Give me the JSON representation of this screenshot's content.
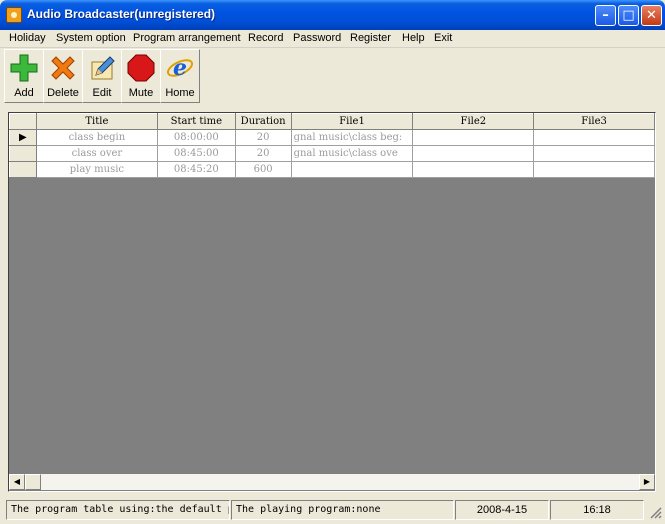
{
  "window": {
    "title": "Audio Broadcaster(unregistered)"
  },
  "menu": [
    "Holiday",
    "System option",
    "Program arrangement",
    "Record",
    "Password",
    "Register",
    "Help",
    "Exit"
  ],
  "toolbar": {
    "add": {
      "label": "Add",
      "icon": "add-icon"
    },
    "delete": {
      "label": "Delete",
      "icon": "delete-icon"
    },
    "edit": {
      "label": "Edit",
      "icon": "edit-icon"
    },
    "mute": {
      "label": "Mute",
      "icon": "mute-icon"
    },
    "home": {
      "label": "Home",
      "icon": "ie-home-icon"
    }
  },
  "grid": {
    "columns": [
      "Title",
      "Start time",
      "Duration",
      "File1",
      "File2",
      "File3"
    ],
    "rows": [
      {
        "title": "class begin",
        "start": "08:00:00",
        "duration": "20",
        "file1": "gnal music\\class beg:",
        "file2": "",
        "file3": ""
      },
      {
        "title": "class over",
        "start": "08:45:00",
        "duration": "20",
        "file1": "gnal music\\class ove",
        "file2": "",
        "file3": ""
      },
      {
        "title": "play music",
        "start": "08:45:20",
        "duration": "600",
        "file1": "",
        "file2": "",
        "file3": ""
      }
    ]
  },
  "status": {
    "program_table": "The program table using:the default p",
    "playing": "The playing program:none",
    "date": "2008-4-15",
    "time": "16:18"
  },
  "colors": {
    "titlebar": "#0054e3",
    "window_bg": "#ece9d8",
    "grid_bg": "#808080",
    "close_button": "#c23a13"
  }
}
